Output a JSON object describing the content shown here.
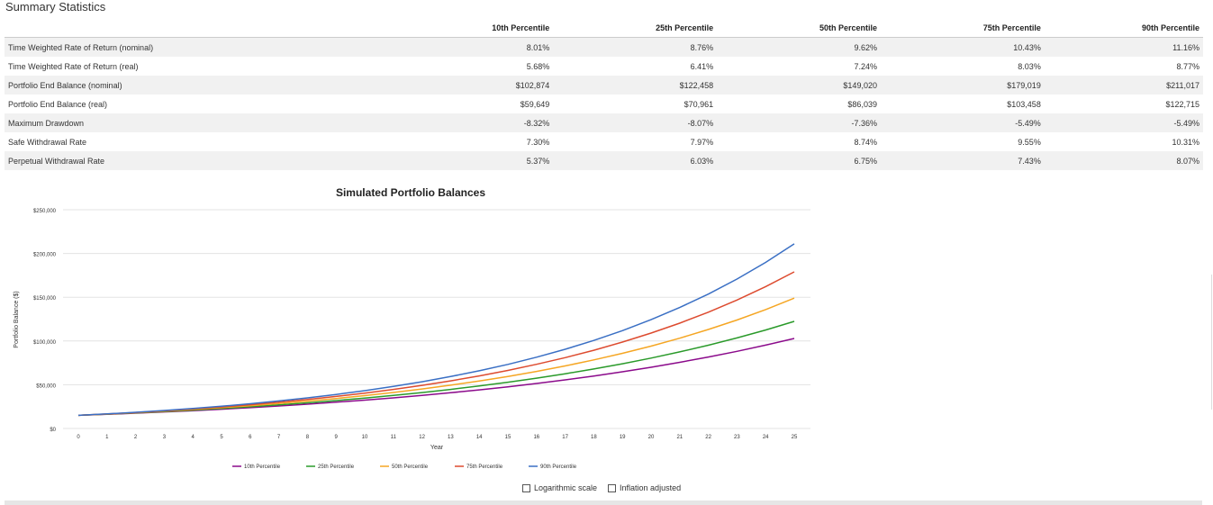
{
  "summary": {
    "title": "Summary Statistics",
    "columns": [
      "10th Percentile",
      "25th Percentile",
      "50th Percentile",
      "75th Percentile",
      "90th Percentile"
    ],
    "rows": [
      {
        "label": "Time Weighted Rate of Return (nominal)",
        "values": [
          "8.01%",
          "8.76%",
          "9.62%",
          "10.43%",
          "11.16%"
        ]
      },
      {
        "label": "Time Weighted Rate of Return (real)",
        "values": [
          "5.68%",
          "6.41%",
          "7.24%",
          "8.03%",
          "8.77%"
        ]
      },
      {
        "label": "Portfolio End Balance (nominal)",
        "values": [
          "$102,874",
          "$122,458",
          "$149,020",
          "$179,019",
          "$211,017"
        ]
      },
      {
        "label": "Portfolio End Balance (real)",
        "values": [
          "$59,649",
          "$70,961",
          "$86,039",
          "$103,458",
          "$122,715"
        ]
      },
      {
        "label": "Maximum Drawdown",
        "values": [
          "-8.32%",
          "-8.07%",
          "-7.36%",
          "-5.49%",
          "-5.49%"
        ]
      },
      {
        "label": "Safe Withdrawal Rate",
        "values": [
          "7.30%",
          "7.97%",
          "8.74%",
          "9.55%",
          "10.31%"
        ]
      },
      {
        "label": "Perpetual Withdrawal Rate",
        "values": [
          "5.37%",
          "6.03%",
          "6.75%",
          "7.43%",
          "8.07%"
        ]
      }
    ]
  },
  "chart_data": {
    "type": "line",
    "title": "Simulated Portfolio Balances",
    "xlabel": "Year",
    "ylabel": "Portfolio Balance ($)",
    "x": [
      0,
      1,
      2,
      3,
      4,
      5,
      6,
      7,
      8,
      9,
      10,
      11,
      12,
      13,
      14,
      15,
      16,
      17,
      18,
      19,
      20,
      21,
      22,
      23,
      24,
      25
    ],
    "ylim": [
      0,
      250000
    ],
    "yticks": [
      0,
      50000,
      100000,
      150000,
      200000,
      250000
    ],
    "ytick_labels": [
      "$0",
      "$50,000",
      "$100,000",
      "$150,000",
      "$200,000",
      "$250,000"
    ],
    "grid": true,
    "legend_position": "bottom",
    "series": [
      {
        "name": "10th Percentile",
        "color": "#8b0a8b",
        "start": 15000,
        "end": 102874
      },
      {
        "name": "25th Percentile",
        "color": "#2a9a2a",
        "start": 15000,
        "end": 122458
      },
      {
        "name": "50th Percentile",
        "color": "#f5a623",
        "start": 15000,
        "end": 149020
      },
      {
        "name": "75th Percentile",
        "color": "#dd4b2f",
        "start": 15000,
        "end": 179019
      },
      {
        "name": "90th Percentile",
        "color": "#3a6fc4",
        "start": 15000,
        "end": 211017
      }
    ]
  },
  "controls": {
    "log_scale_label": "Logarithmic scale",
    "inflation_label": "Inflation adjusted"
  }
}
